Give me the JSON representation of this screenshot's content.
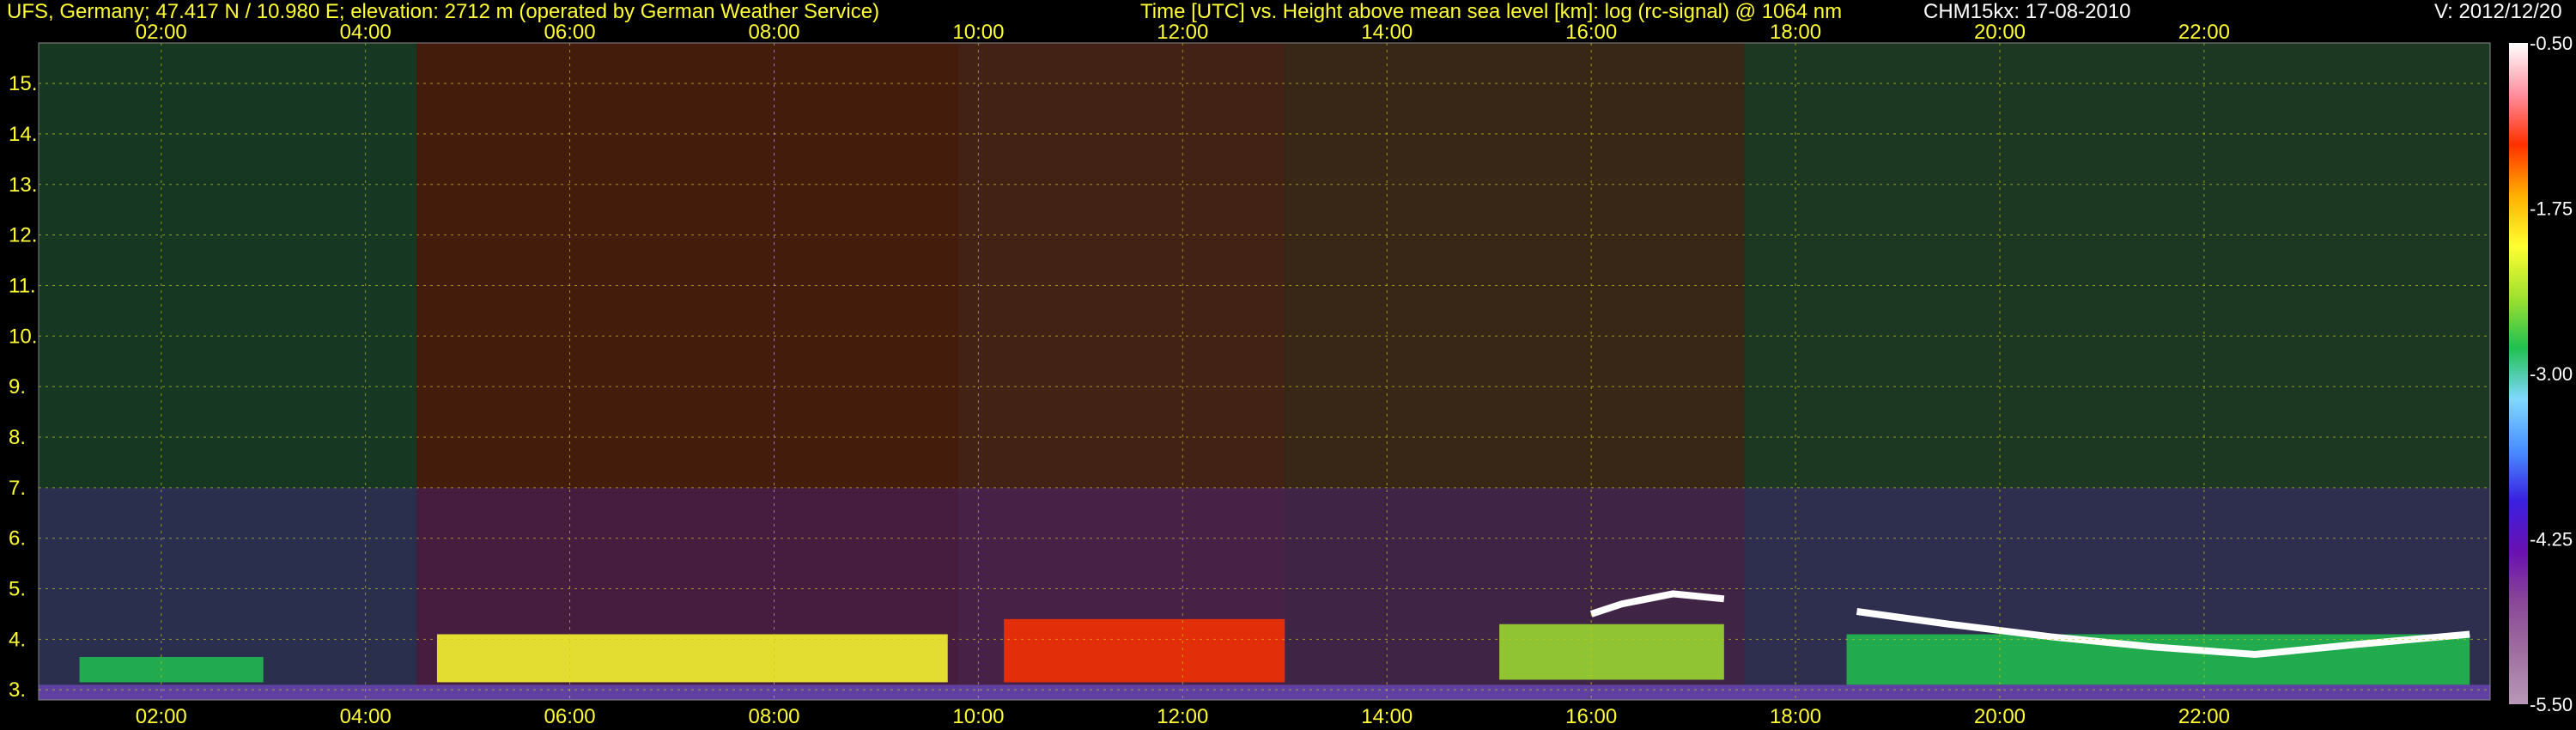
{
  "header": {
    "site": "UFS, Germany; 47.417 N / 10.980 E; elevation: 2712 m  (operated by German Weather Service)",
    "description": "Time [UTC] vs. Height above mean sea level [km]: log (rc-signal) @ 1064 nm",
    "instrument": "CHM15kx: 17-08-2010",
    "version": "V: 2012/12/20"
  },
  "colors": {
    "background": "#000000",
    "axis_text": "#ffff33",
    "header_text": "#ffffff",
    "grid": "#cccc00"
  },
  "chart_data": {
    "type": "heatmap",
    "title": "Time [UTC] vs. Height above mean sea level [km]: log (rc-signal) @ 1064 nm",
    "xlabel": "Time [UTC]",
    "ylabel": "Height above mean sea level [km]",
    "xlim": [
      0.8,
      24.8
    ],
    "ylim": [
      2.8,
      15.8
    ],
    "x_ticks": [
      {
        "value": 2,
        "label": "02:00"
      },
      {
        "value": 4,
        "label": "04:00"
      },
      {
        "value": 6,
        "label": "06:00"
      },
      {
        "value": 8,
        "label": "08:00"
      },
      {
        "value": 10,
        "label": "10:00"
      },
      {
        "value": 12,
        "label": "12:00"
      },
      {
        "value": 14,
        "label": "14:00"
      },
      {
        "value": 16,
        "label": "16:00"
      },
      {
        "value": 18,
        "label": "18:00"
      },
      {
        "value": 20,
        "label": "20:00"
      },
      {
        "value": 22,
        "label": "22:00"
      }
    ],
    "y_ticks": [
      {
        "value": 3,
        "label": "3."
      },
      {
        "value": 4,
        "label": "4."
      },
      {
        "value": 5,
        "label": "5."
      },
      {
        "value": 6,
        "label": "6."
      },
      {
        "value": 7,
        "label": "7."
      },
      {
        "value": 8,
        "label": "8."
      },
      {
        "value": 9,
        "label": "9."
      },
      {
        "value": 10,
        "label": "10."
      },
      {
        "value": 11,
        "label": "11."
      },
      {
        "value": 12,
        "label": "12."
      },
      {
        "value": 13,
        "label": "13."
      },
      {
        "value": 14,
        "label": "14."
      },
      {
        "value": 15,
        "label": "15."
      }
    ],
    "grid": true,
    "colorbar": {
      "range": [
        -5.5,
        -0.5
      ],
      "labels": [
        {
          "value": -0.5,
          "label": "-0.50"
        },
        {
          "value": -1.75,
          "label": "-1.75"
        },
        {
          "value": -3.0,
          "label": "-3.00"
        },
        {
          "value": -4.25,
          "label": "-4.25"
        },
        {
          "value": -5.5,
          "label": "-5.50"
        }
      ],
      "stops": [
        "#b898b8",
        "#a070a0",
        "#8a4898",
        "#6a10b0",
        "#3a20e0",
        "#4890ff",
        "#80d8ff",
        "#20c050",
        "#a0e030",
        "#ffff30",
        "#ffb000",
        "#ff3000",
        "#ff90a0",
        "#ffffff"
      ]
    },
    "background_tint": [
      {
        "x": [
          0.8,
          4.5
        ],
        "color": "#40a060"
      },
      {
        "x": [
          4.5,
          9.8
        ],
        "color": "#c05020"
      },
      {
        "x": [
          9.8,
          13.0
        ],
        "color": "#c06040"
      },
      {
        "x": [
          13.0,
          17.5
        ],
        "color": "#a07040"
      },
      {
        "x": [
          17.5,
          24.8
        ],
        "color": "#50a060"
      }
    ],
    "aerosol_layers": [
      {
        "x": [
          1.2,
          3.0
        ],
        "y": [
          3.15,
          3.65
        ],
        "intensity": -2.9
      },
      {
        "x": [
          4.7,
          9.7
        ],
        "y": [
          3.15,
          4.1
        ],
        "intensity": -2.1
      },
      {
        "x": [
          10.25,
          13.0
        ],
        "y": [
          3.15,
          4.4
        ],
        "intensity": -1.3
      },
      {
        "x": [
          15.1,
          17.3
        ],
        "y": [
          3.2,
          4.3
        ],
        "intensity": -2.3
      },
      {
        "x": [
          18.5,
          24.6
        ],
        "y": [
          3.1,
          4.1
        ],
        "intensity": -2.7
      }
    ],
    "cloud_layers": [
      {
        "points": [
          [
            16.0,
            4.5
          ],
          [
            16.3,
            4.7
          ],
          [
            16.8,
            4.9
          ],
          [
            17.3,
            4.8
          ]
        ],
        "intensity": -0.6
      },
      {
        "points": [
          [
            18.6,
            4.55
          ],
          [
            19.5,
            4.3
          ],
          [
            20.5,
            4.05
          ],
          [
            21.5,
            3.85
          ],
          [
            22.5,
            3.7
          ],
          [
            23.5,
            3.9
          ],
          [
            24.6,
            4.1
          ]
        ],
        "intensity": -0.6
      }
    ]
  }
}
